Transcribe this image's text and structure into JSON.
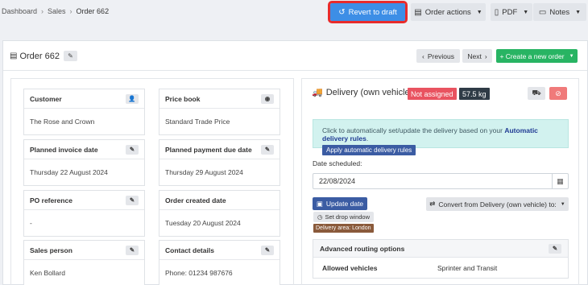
{
  "breadcrumb": {
    "items": [
      "Dashboard",
      "Sales",
      "Order 662"
    ],
    "separator": "›"
  },
  "toolbar": {
    "revert_label": "Revert to draft",
    "order_actions_label": "Order actions",
    "pdf_label": "PDF",
    "notes_label": "Notes"
  },
  "order": {
    "title": "Order 662",
    "prev_label": "Previous",
    "next_label": "Next",
    "create_label": "+ Create a new order"
  },
  "cards": [
    {
      "title": "Customer",
      "value": "The Rose and Crown",
      "icon": "person-icon"
    },
    {
      "title": "Price book",
      "value": "Standard Trade Price",
      "icon": "eye-icon"
    },
    {
      "title": "Planned invoice date",
      "value": "Thursday 22 August 2024",
      "icon": "pencil-icon"
    },
    {
      "title": "Planned payment due date",
      "value": "Thursday 29 August 2024",
      "icon": "pencil-icon"
    },
    {
      "title": "PO reference",
      "value": "-",
      "icon": "pencil-icon"
    },
    {
      "title": "Order created date",
      "value": "Tuesday 20 August 2024",
      "icon": ""
    },
    {
      "title": "Sales person",
      "value": "Ken Bollard",
      "icon": "pencil-icon"
    },
    {
      "title": "Contact details",
      "value": "Phone: 01234 987676",
      "icon": "pencil-icon"
    }
  ],
  "delivery": {
    "title": "Delivery (own vehicle)",
    "status_badge": "Not assigned",
    "weight_badge": "57.5 kg",
    "info_text": "Click to automatically set/update the delivery based on your",
    "info_link": "Automatic delivery rules",
    "info_suffix": ".",
    "apply_button": "Apply automatic delivery rules",
    "date_label": "Date scheduled:",
    "date_value": "22/08/2024",
    "update_button": "Update date",
    "convert_button": "Convert from Delivery (own vehicle) to:",
    "drop_window_button": "Set drop window",
    "area_badge": "Delivery area: London",
    "routing_title": "Advanced routing options",
    "routing_rows": [
      {
        "key": "Allowed vehicles",
        "value": "Sprinter and Transit"
      }
    ]
  },
  "colors": {
    "revert_bg": "#3d8ee6",
    "highlight_outline": "#e82b2b",
    "create_bg": "#28b463",
    "status_badge_bg": "#e95360",
    "weight_badge_bg": "#2f3b46",
    "info_bg": "#d2f2ef",
    "primary_dark": "#3b5ca3",
    "area_badge_bg": "#8a5a3b"
  }
}
